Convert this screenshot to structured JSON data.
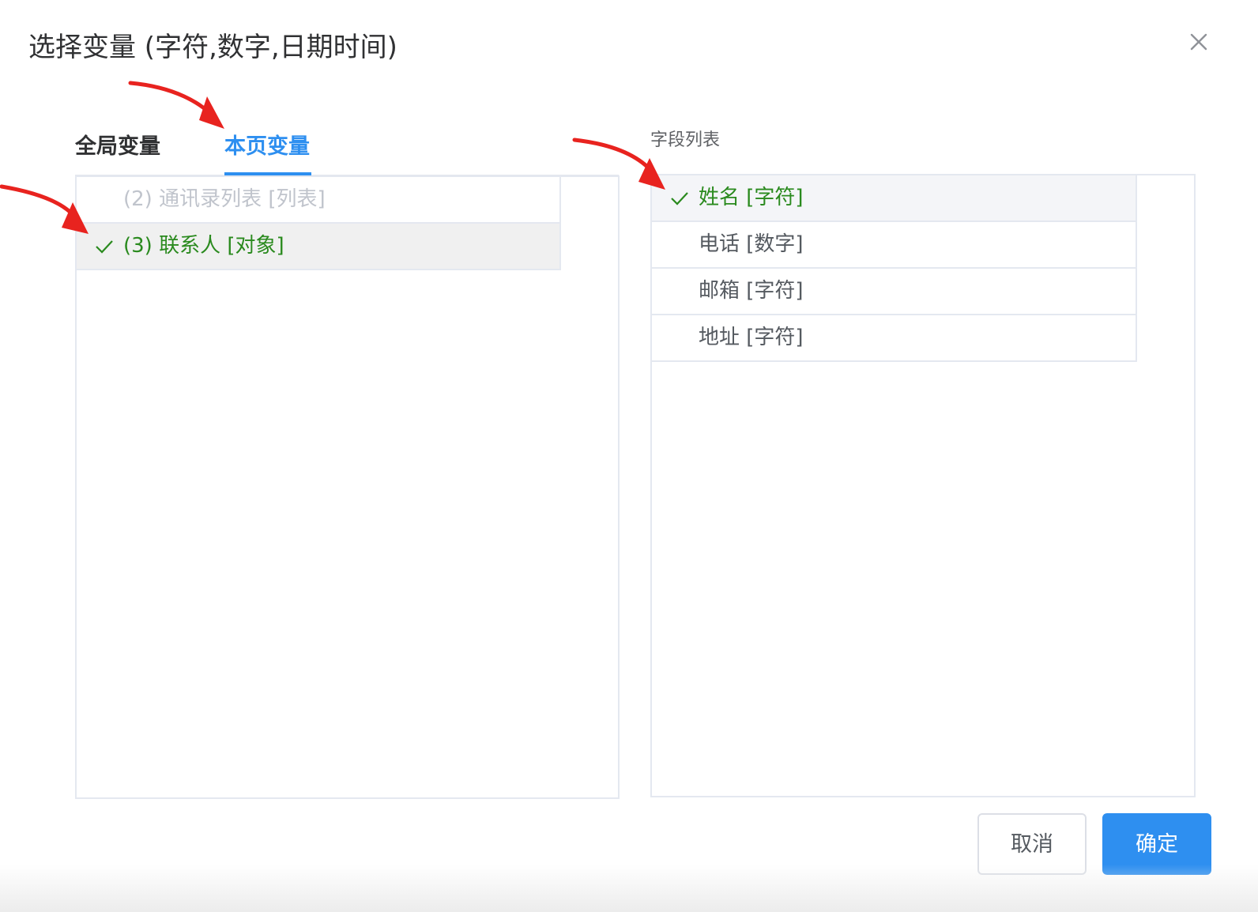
{
  "dialog": {
    "title": "选择变量 (字符,数字,日期时间)"
  },
  "tabs": [
    {
      "label": "全局变量",
      "active": false
    },
    {
      "label": "本页变量",
      "active": true
    }
  ],
  "variables": {
    "items": [
      {
        "label": "(2) 通讯录列表 [列表]",
        "state": "disabled"
      },
      {
        "label": "(3) 联系人 [对象]",
        "state": "selected"
      }
    ]
  },
  "fields": {
    "header": "字段列表",
    "items": [
      {
        "label": "姓名 [字符]",
        "selected": true
      },
      {
        "label": "电话 [数字]",
        "selected": false
      },
      {
        "label": "邮箱 [字符]",
        "selected": false
      },
      {
        "label": "地址 [字符]",
        "selected": false
      }
    ]
  },
  "buttons": {
    "cancel": "取消",
    "ok": "确定"
  },
  "colors": {
    "accent": "#2e8ff0",
    "selected_text": "#2a8a1e",
    "annotation_arrow": "#e8231f"
  },
  "icons": [
    "close-icon",
    "check-icon"
  ]
}
